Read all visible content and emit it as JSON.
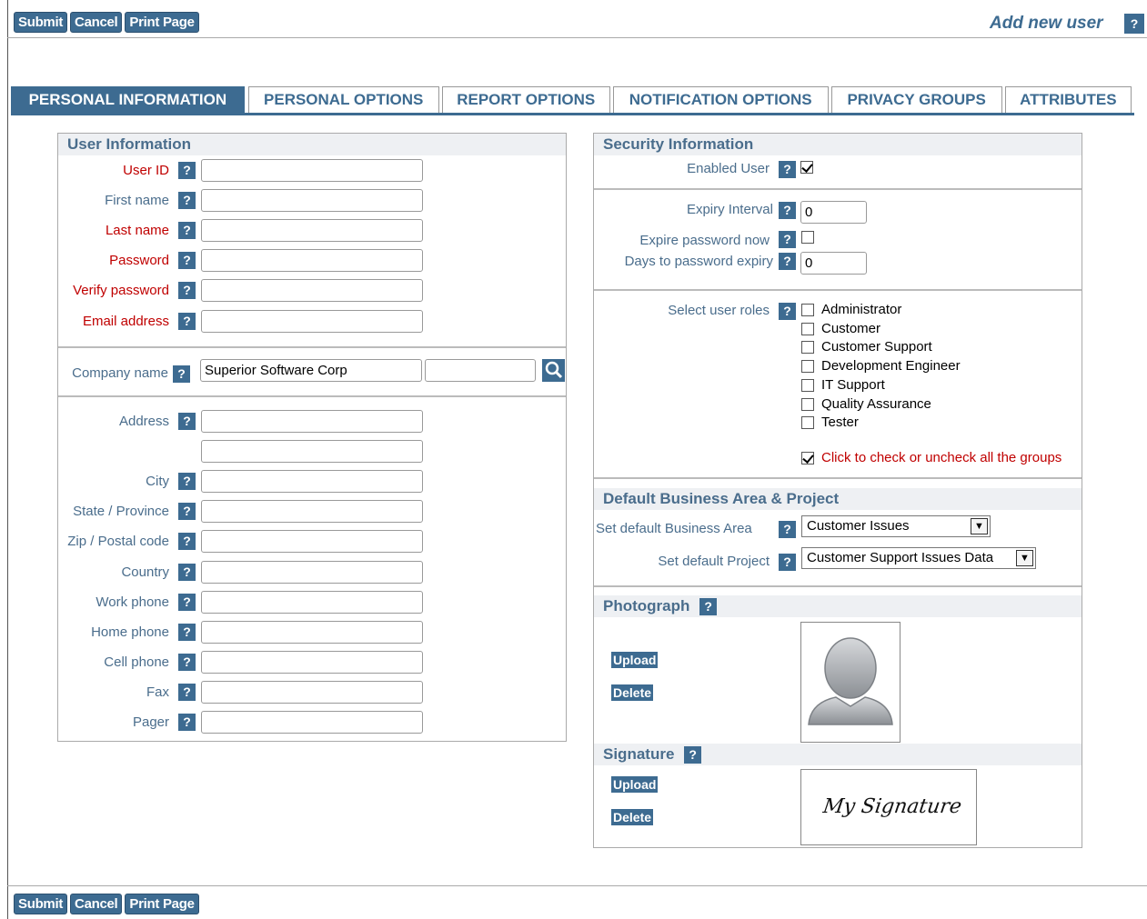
{
  "toolbar": {
    "submit": "Submit",
    "cancel": "Cancel",
    "print": "Print Page"
  },
  "header": {
    "title": "Add new user",
    "help": "?"
  },
  "tabs": [
    {
      "label": "PERSONAL INFORMATION",
      "active": true
    },
    {
      "label": "PERSONAL OPTIONS"
    },
    {
      "label": "REPORT OPTIONS"
    },
    {
      "label": "NOTIFICATION OPTIONS"
    },
    {
      "label": "PRIVACY GROUPS"
    },
    {
      "label": "ATTRIBUTES"
    }
  ],
  "user_info": {
    "title": "User Information",
    "fields": [
      {
        "label": "User ID",
        "required": true,
        "value": ""
      },
      {
        "label": "First name",
        "required": false,
        "value": ""
      },
      {
        "label": "Last name",
        "required": true,
        "value": ""
      },
      {
        "label": "Password",
        "required": true,
        "value": ""
      },
      {
        "label": "Verify password",
        "required": true,
        "value": ""
      },
      {
        "label": "Email address",
        "required": true,
        "value": ""
      }
    ],
    "company": {
      "label": "Company name",
      "value": "Superior Software Corp",
      "value2": ""
    },
    "address_fields": [
      {
        "label": "Address",
        "value": ""
      },
      {
        "label": "",
        "value": ""
      },
      {
        "label": "City",
        "value": ""
      },
      {
        "label": "State / Province",
        "value": ""
      },
      {
        "label": "Zip / Postal code",
        "value": ""
      },
      {
        "label": "Country",
        "value": ""
      },
      {
        "label": "Work phone",
        "value": ""
      },
      {
        "label": "Home phone",
        "value": ""
      },
      {
        "label": "Cell phone",
        "value": ""
      },
      {
        "label": "Fax",
        "value": ""
      },
      {
        "label": "Pager",
        "value": ""
      }
    ]
  },
  "security": {
    "title": "Security Information",
    "enabled_label": "Enabled User",
    "enabled": true,
    "expiry_interval_label": "Expiry Interval",
    "expiry_interval": "0",
    "expire_now_label": "Expire password now",
    "expire_now": false,
    "days_label": "Days to password expiry",
    "days": "0",
    "roles_label": "Select user roles",
    "roles": [
      {
        "label": "Administrator",
        "checked": false
      },
      {
        "label": "Customer",
        "checked": false
      },
      {
        "label": "Customer Support",
        "checked": false
      },
      {
        "label": "Development Engineer",
        "checked": false
      },
      {
        "label": "IT Support",
        "checked": false
      },
      {
        "label": "Quality Assurance",
        "checked": false
      },
      {
        "label": "Tester",
        "checked": false
      }
    ],
    "toggle_all_label": "Click to check or uncheck all the groups",
    "toggle_all": true
  },
  "defaults": {
    "title": "Default Business Area & Project",
    "area_label": "Set default Business Area",
    "area_value": "Customer Issues",
    "project_label": "Set default Project",
    "project_value": "Customer Support Issues Data"
  },
  "photo": {
    "title": "Photograph",
    "upload": "Upload",
    "delete": "Delete",
    "icon": "person-silhouette-icon"
  },
  "signature": {
    "title": "Signature",
    "upload": "Upload",
    "delete": "Delete",
    "text": "My Signature"
  },
  "colors": {
    "accent": "#3d6b91",
    "required": "#c00000",
    "label": "#4a6d8c"
  }
}
